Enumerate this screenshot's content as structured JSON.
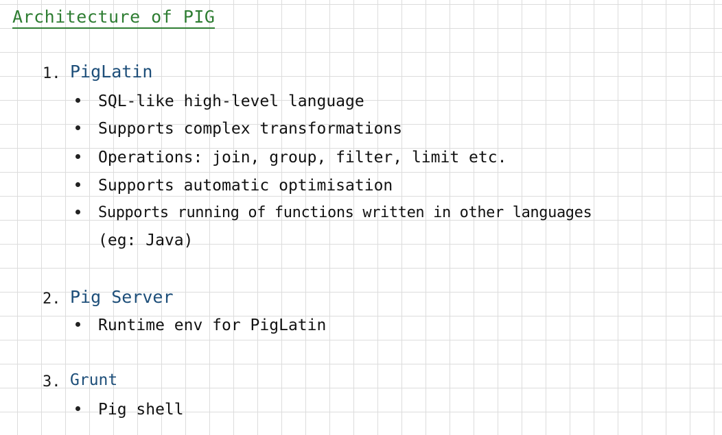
{
  "title": "Architecture of PIG",
  "sections": [
    {
      "number": "1.",
      "heading": "PigLatin",
      "bullets": [
        "SQL-like high-level language",
        "Supports complex transformations",
        "Operations: join, group, filter, limit etc.",
        "Supports automatic optimisation",
        "Supports running of functions written in other languages"
      ],
      "continuation": "(eg: Java)"
    },
    {
      "number": "2.",
      "heading": "Pig Server",
      "bullets": [
        "Runtime env for PigLatin"
      ]
    },
    {
      "number": "3.",
      "heading": "Grunt",
      "bullets": [
        "Pig shell"
      ]
    }
  ]
}
